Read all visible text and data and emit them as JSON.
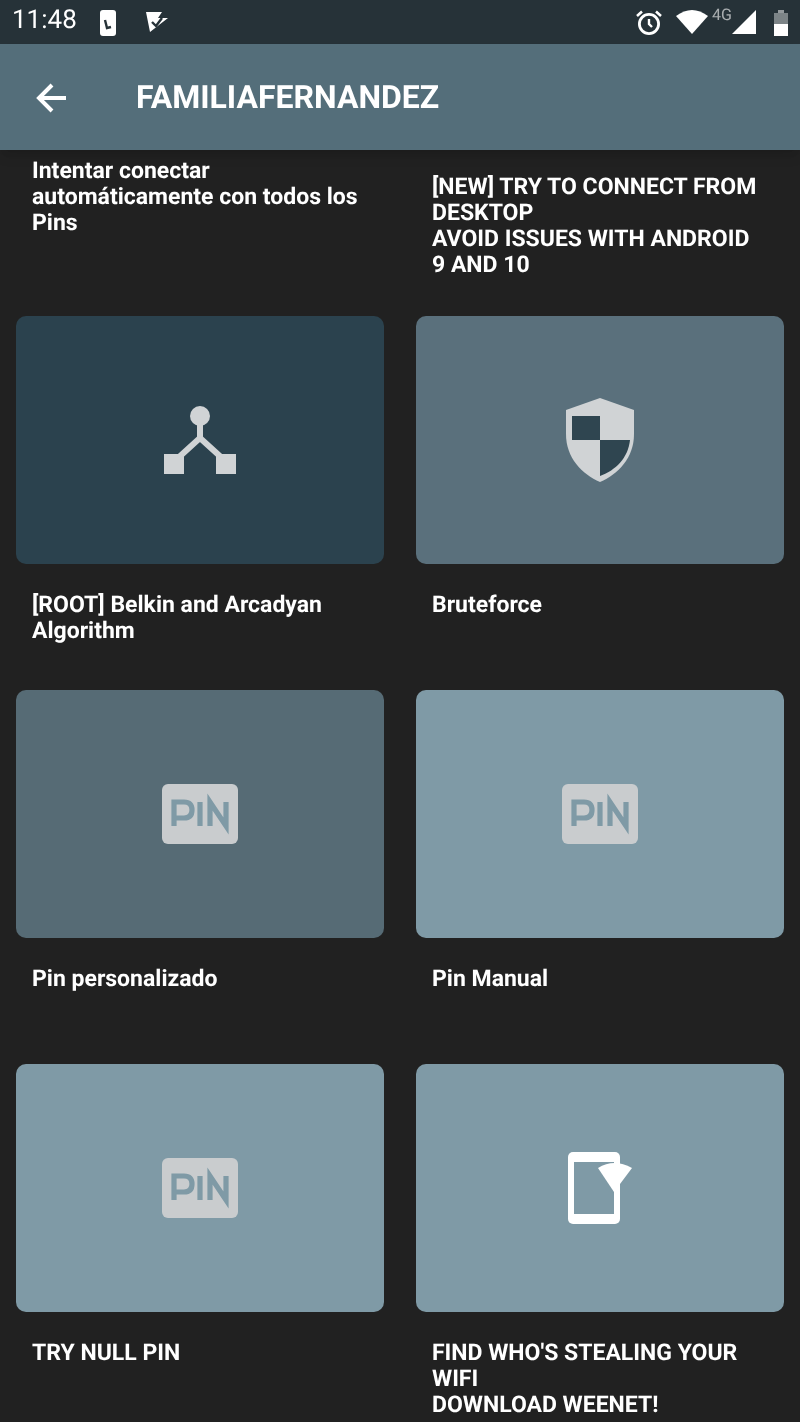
{
  "status_bar": {
    "time": "11:48",
    "network": "4G"
  },
  "app_bar": {
    "title": "FAMILIAFERNANDEZ"
  },
  "top_labels": [
    "Intentar conectar automáticamente con todos los Pins",
    "[NEW] TRY TO CONNECT FROM DESKTOP\nAVOID ISSUES WITH ANDROID 9 AND 10"
  ],
  "cards": [
    {
      "kind": "algorithm",
      "color": "#2b424e",
      "label": "[ROOT] Belkin and Arcadyan Algorithm"
    },
    {
      "kind": "shield",
      "color": "#5a707c",
      "label": "Bruteforce"
    },
    {
      "kind": "pin",
      "color": "#566b75",
      "label": "Pin personalizado"
    },
    {
      "kind": "pin",
      "color": "#7f9aa6",
      "label": "Pin Manual"
    },
    {
      "kind": "pin",
      "color": "#7f9aa6",
      "label": "TRY NULL PIN"
    },
    {
      "kind": "phone-wifi",
      "color": "#7f9aa6",
      "label": "FIND WHO'S STEALING YOUR WIFI\nDOWNLOAD WEENET!"
    }
  ]
}
